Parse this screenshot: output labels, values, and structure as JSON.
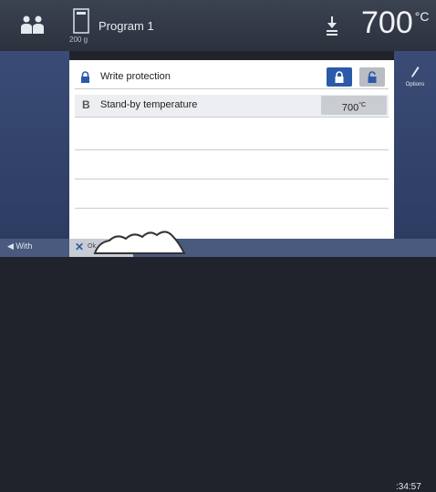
{
  "header": {
    "program_weight": "200 g",
    "program_name": "Program 1",
    "temperature_value": "700",
    "temperature_unit": "°C"
  },
  "settings": [
    {
      "icon": "lock-icon",
      "label": "Write protection",
      "control": "toggle",
      "state": "locked"
    },
    {
      "letter": "B",
      "label": "Stand-by temperature",
      "value": "700",
      "unit": "°C"
    }
  ],
  "sidebar": {
    "options_label": "Options"
  },
  "footer": {
    "back_label": "◀ With",
    "close_icon": "✕",
    "close_label": "Ok",
    "clock": ":34:57"
  },
  "colors": {
    "accent": "#2a5aa8",
    "panel": "#3a4c76"
  }
}
